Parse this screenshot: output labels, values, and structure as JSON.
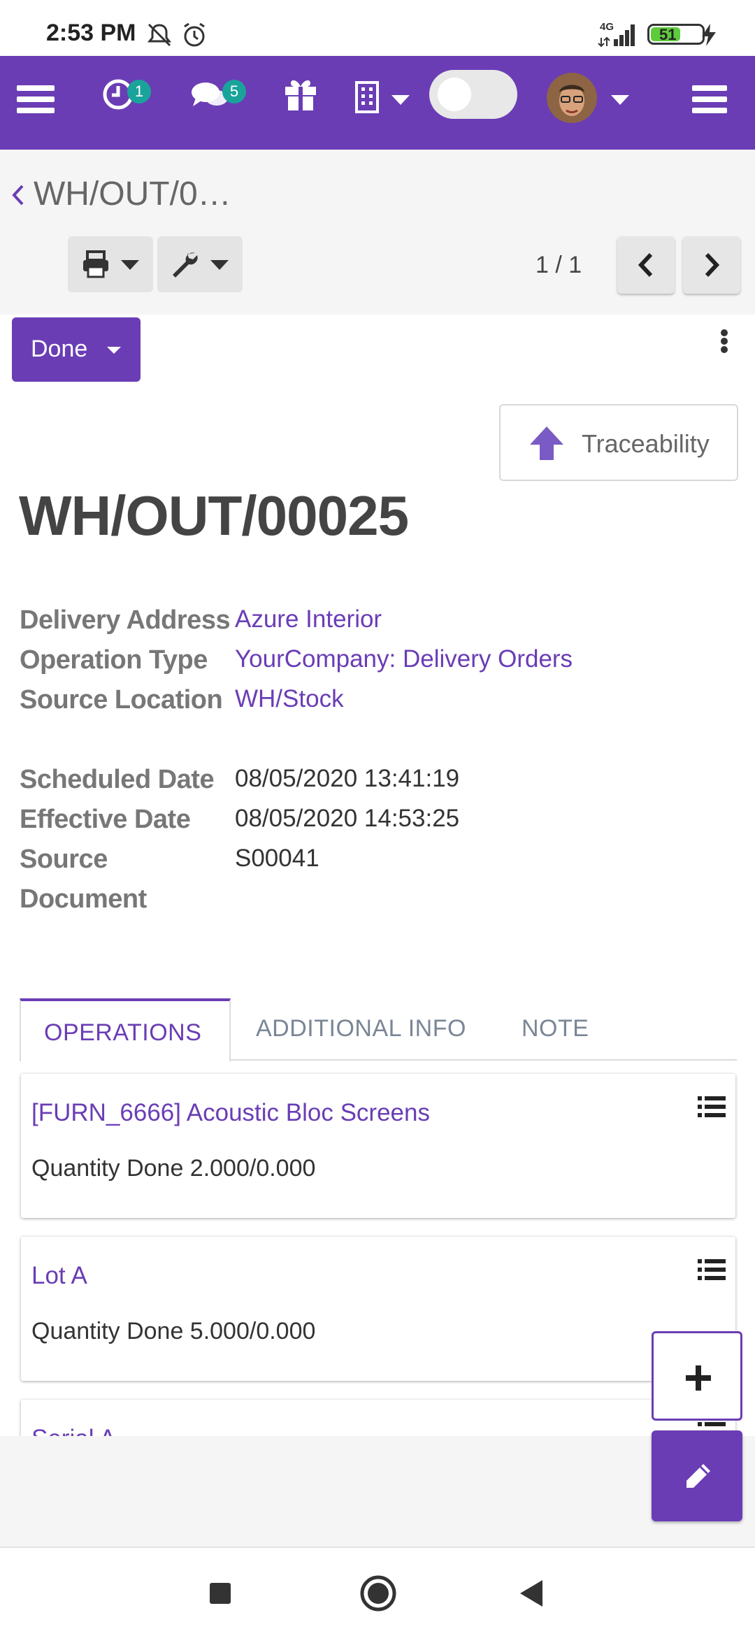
{
  "status_bar": {
    "time": "2:53 PM",
    "network": "4G",
    "battery": "51"
  },
  "navbar": {
    "activity_badge": "1",
    "messages_badge": "5"
  },
  "breadcrumb": {
    "title": "WH/OUT/0…"
  },
  "pager": {
    "value": "1 / 1"
  },
  "status_button": {
    "label": "Done"
  },
  "traceability_button": {
    "label": "Traceability"
  },
  "record": {
    "name": "WH/OUT/00025",
    "fields": {
      "delivery_address_label": "Delivery Address",
      "delivery_address_value": "Azure Interior",
      "operation_type_label": "Operation Type",
      "operation_type_value": "YourCompany: Delivery Orders",
      "source_location_label": "Source Location",
      "source_location_value": "WH/Stock",
      "scheduled_date_label": "Scheduled Date",
      "scheduled_date_value": "08/05/2020 13:41:19",
      "effective_date_label": "Effective Date",
      "effective_date_value": "08/05/2020 14:53:25",
      "source_document_label_1": "Source",
      "source_document_label_2": "Document",
      "source_document_value": "S00041"
    }
  },
  "tabs": [
    {
      "label": "OPERATIONS",
      "active": true
    },
    {
      "label": "ADDITIONAL INFO",
      "active": false
    },
    {
      "label": "NOTE",
      "active": false
    }
  ],
  "operations": [
    {
      "title": "[FURN_6666] Acoustic Bloc Screens",
      "quantity": "Quantity Done 2.000/0.000"
    },
    {
      "title": "Lot A",
      "quantity": "Quantity Done 5.000/0.000"
    },
    {
      "title": "Serial A",
      "quantity": ""
    }
  ],
  "colors": {
    "brand": "#6a3db5",
    "badge": "#1aa39a"
  }
}
